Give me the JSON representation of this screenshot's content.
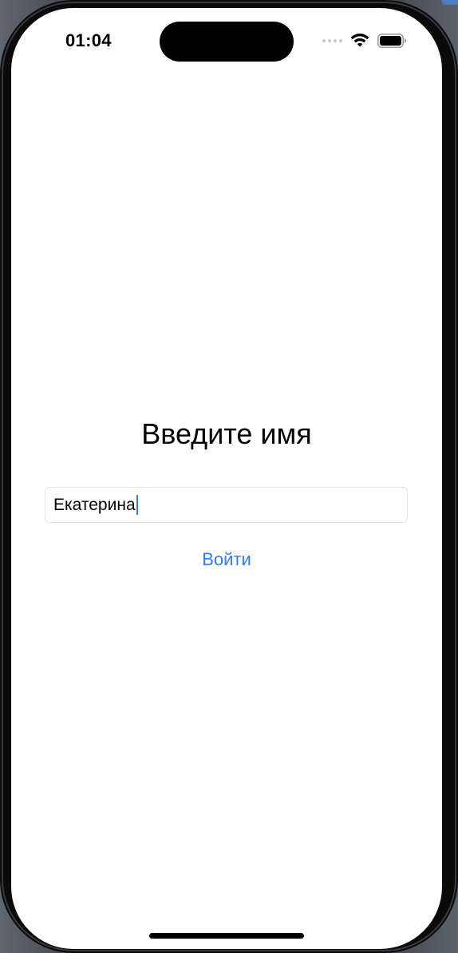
{
  "status_bar": {
    "time": "01:04"
  },
  "screen": {
    "title": "Введите имя",
    "name_field": {
      "value": "Екатерина",
      "placeholder": ""
    },
    "login_button_label": "Войти"
  },
  "colors": {
    "accent": "#2F7CF6",
    "background": "#FFFFFF",
    "text": "#000000"
  },
  "icons": [
    "signal-dots-icon",
    "wifi-icon",
    "battery-icon"
  ]
}
